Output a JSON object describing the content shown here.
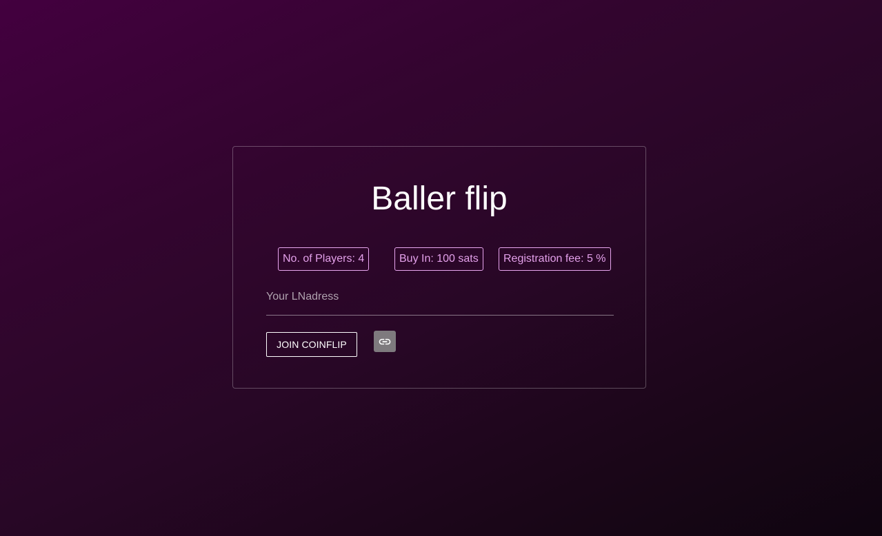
{
  "card": {
    "title": "Baller flip",
    "chips": {
      "players": "No. of Players: 4",
      "buyin": "Buy In: 100 sats",
      "fee": "Registration fee: 5 %"
    },
    "ln_input": {
      "placeholder": "Your LNadress",
      "value": ""
    },
    "join_label": "JOIN COINFLIP",
    "link_icon": "link-icon"
  },
  "colors": {
    "chip_border": "#e9a6f0",
    "chip_text": "#e3a0ea",
    "link_button_bg": "#7e7a7e"
  }
}
